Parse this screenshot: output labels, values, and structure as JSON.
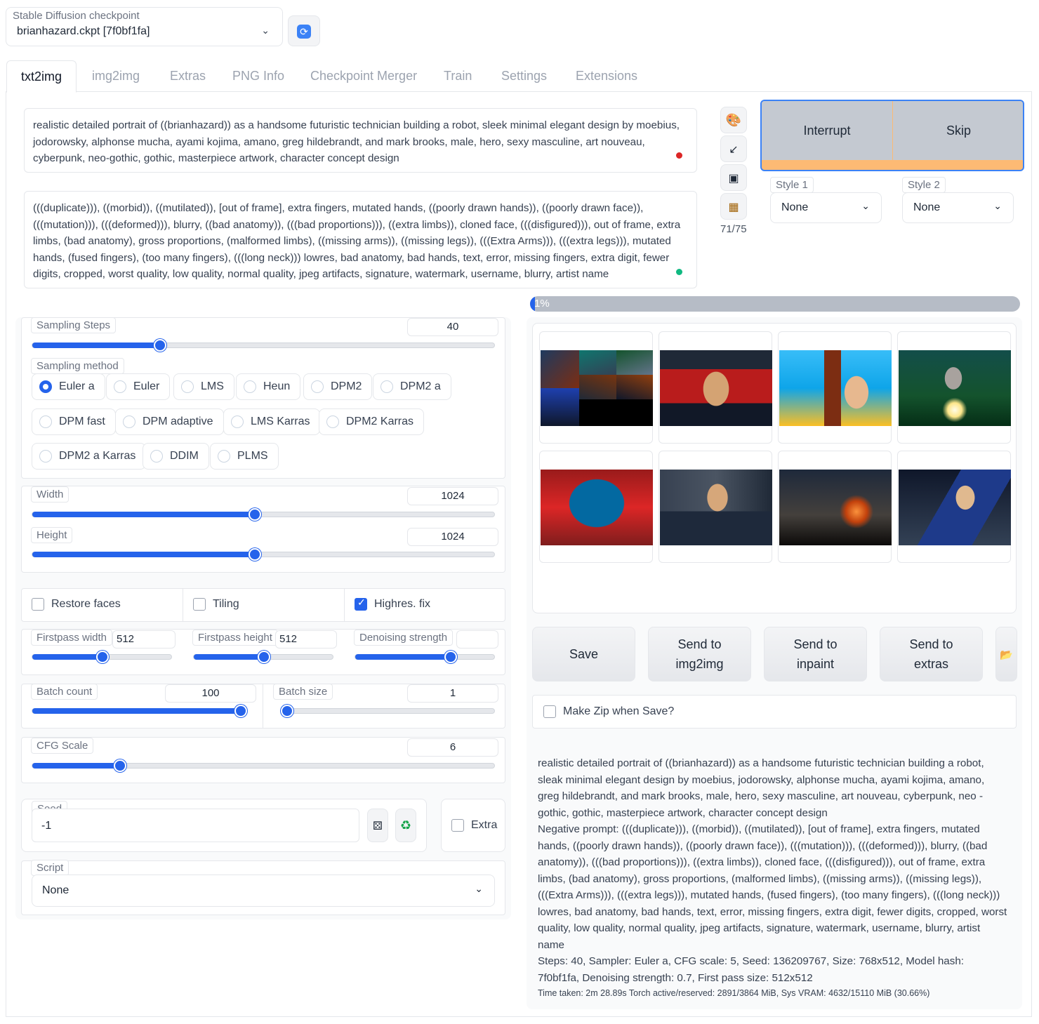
{
  "checkpoint": {
    "label": "Stable Diffusion checkpoint",
    "value": "brianhazard.ckpt [7f0bf1fa]"
  },
  "tabs": [
    "txt2img",
    "img2img",
    "Extras",
    "PNG Info",
    "Checkpoint Merger",
    "Train",
    "Settings",
    "Extensions"
  ],
  "prompt": {
    "positive": "realistic detailed portrait of ((brianhazard)) as a handsome futuristic technician building a robot, sleek minimal elegant design by moebius, jodorowsky, alphonse mucha, ayami kojima, amano, greg hildebrandt, and mark brooks, male, hero, sexy masculine, art nouveau, cyberpunk, neo-gothic, gothic, masterpiece artwork, character concept design",
    "negative": "(((duplicate))), ((morbid)), ((mutilated)), [out of frame], extra fingers, mutated hands, ((poorly drawn hands)), ((poorly drawn face)), (((mutation))), (((deformed))), blurry, ((bad anatomy)), (((bad proportions))), ((extra limbs)), cloned face, (((disfigured))), out of frame, extra limbs, (bad anatomy), gross proportions, (malformed limbs), ((missing arms)), ((missing legs)), (((Extra Arms))), (((extra legs))), mutated hands, (fused fingers), (too many fingers), (((long neck))) lowres, bad anatomy, bad hands, text, error, missing fingers, extra digit, fewer digits, cropped, worst quality, low quality, normal quality, jpeg artifacts, signature, watermark, username, blurry, artist name",
    "token_count": "71/75"
  },
  "actions": {
    "interrupt": "Interrupt",
    "skip": "Skip"
  },
  "styles": {
    "style1_label": "Style 1",
    "style1_value": "None",
    "style2_label": "Style 2",
    "style2_value": "None"
  },
  "progress": {
    "text": "1%",
    "value": 0.01
  },
  "sampling": {
    "steps_label": "Sampling Steps",
    "steps": "40",
    "steps_fraction": 0.27,
    "method_label": "Sampling method",
    "methods": [
      "Euler a",
      "Euler",
      "LMS",
      "Heun",
      "DPM2",
      "DPM2 a",
      "DPM fast",
      "DPM adaptive",
      "LMS Karras",
      "DPM2 Karras",
      "DPM2 a Karras",
      "DDIM",
      "PLMS"
    ],
    "selected": "Euler a"
  },
  "size": {
    "width_label": "Width",
    "width": "1024",
    "width_fraction": 0.48,
    "height_label": "Height",
    "height": "1024",
    "height_fraction": 0.48
  },
  "options": {
    "restore_faces": "Restore faces",
    "tiling": "Tiling",
    "highres": "Highres. fix"
  },
  "highres": {
    "fp_width_label": "Firstpass width",
    "fp_width": "512",
    "fp_width_fraction": 0.5,
    "fp_height_label": "Firstpass height",
    "fp_height": "512",
    "fp_height_fraction": 0.5,
    "denoise_label": "Denoising strength",
    "denoise_fraction": 0.7
  },
  "batch": {
    "count_label": "Batch count",
    "count": "100",
    "count_fraction": 1.0,
    "size_label": "Batch size",
    "size": "1",
    "size_fraction": 0.0
  },
  "cfg": {
    "label": "CFG Scale",
    "value": "6",
    "fraction": 0.18
  },
  "seed": {
    "label": "Seed",
    "value": "-1",
    "extra": "Extra"
  },
  "script": {
    "label": "Script",
    "value": "None"
  },
  "output_buttons": {
    "save": "Save",
    "img2img": "Send to img2img",
    "inpaint": "Send to inpaint",
    "extras": "Send to extras"
  },
  "zip_label": "Make Zip when Save?",
  "info": {
    "prompt": "realistic detailed portrait of ((brianhazard)) as a handsome futuristic technician building a robot, sleak minimal elegant design by moebius, jodorowsky, alphonse mucha, ayami kojima, amano, greg hildebrandt, and mark brooks, male, hero, sexy masculine, art nouveau, cyberpunk, neo - gothic, gothic, masterpiece artwork, character concept design",
    "negative": "Negative prompt: (((duplicate))), ((morbid)), ((mutilated)), [out of frame], extra fingers, mutated hands, ((poorly drawn hands)), ((poorly drawn face)), (((mutation))), (((deformed))), blurry, ((bad anatomy)), (((bad proportions))), ((extra limbs)), cloned face, (((disfigured))), out of frame, extra limbs, (bad anatomy), gross proportions, (malformed limbs), ((missing arms)), ((missing legs)), (((Extra Arms))), (((extra legs))), mutated hands, (fused fingers), (too many fingers), (((long neck))) lowres, bad anatomy, bad hands, text, error, missing fingers, extra digit, fewer digits, cropped, worst quality, low quality, normal quality, jpeg artifacts, signature, watermark, username, blurry, artist name",
    "params": "Steps: 40, Sampler: Euler a, CFG scale: 5, Seed: 136209767, Size: 768x512, Model hash: 7f0bf1fa, Denoising strength: 0.7, First pass size: 512x512",
    "timing": "Time taken: 2m 28.89s  Torch active/reserved: 2891/3864 MiB, Sys VRAM: 4632/15110 MiB (30.66%)"
  },
  "colors": {
    "accent": "#2563eb",
    "progress_orange": "#fdba74"
  }
}
